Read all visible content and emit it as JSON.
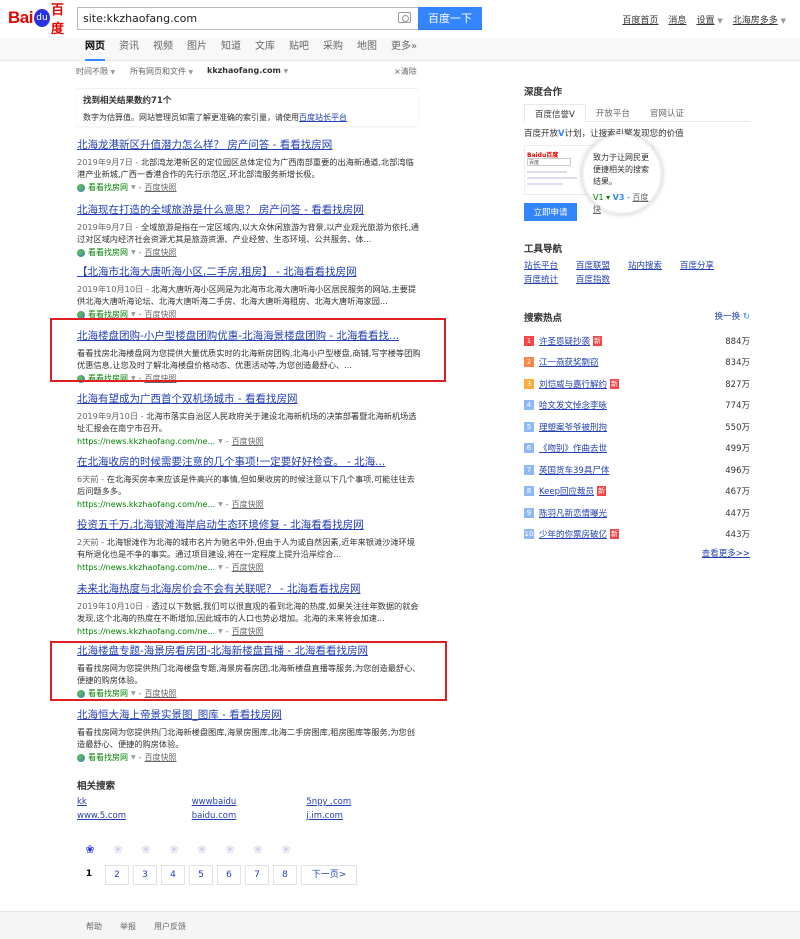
{
  "header": {
    "logo_bai": "Bai",
    "logo_du": "du",
    "logo_cn": "百度",
    "search_value": "site:kkzhaofang.com",
    "search_button": "百度一下",
    "links": [
      "百度首页",
      "消息",
      "设置",
      "北海房多多"
    ]
  },
  "tabs": [
    "网页",
    "资讯",
    "视频",
    "图片",
    "知道",
    "文库",
    "贴吧",
    "采购",
    "地图",
    "更多»"
  ],
  "filter": {
    "time": "时间不限",
    "type": "所有网页和文件",
    "site": "kkzhaofang.com",
    "clear": "清除"
  },
  "notice": {
    "title": "找到相关结果数约71个",
    "desc": "数字为估算值。网站管理员如需了解更准确的索引量，请使用",
    "link": "百度站长平台"
  },
  "results": [
    {
      "title": "北海龙港新区升值潜力怎么样？ 房产问答 - 看看找房网",
      "date": "2019年9月7日 - ",
      "abstract": "北部湾龙港新区的定位园区总体定位为广西南部重要的出海新通道,北部湾临港产业新城,广西一香港合作的先行示范区,环北部湾服务新增长极。",
      "src": "看看找房网",
      "cache": "百度快照"
    },
    {
      "title": "北海现在打造的全域旅游是什么意思？ 房产问答 - 看看找房网",
      "date": "2019年9月7日 - ",
      "abstract": "全域旅游是指在一定区域内,以大众休闲旅游为背景,以产业观光旅游为依托,通过对区域内经济社会资源尤其是旅游资源、产业经营、生态环境、公共服务、体...",
      "src": "看看找房网",
      "cache": "百度快照"
    },
    {
      "title": "【北海市北海大唐听海小区,二手房,租房】 - 北海看看找房网",
      "date": "2019年10月10日 - ",
      "abstract": "北海大唐听海小区网是为北海市北海大唐听海小区居民服务的网站,主要提供北海大唐听海论坛、北海大唐听海二手房、北海大唐听海租房、北海大唐听海家园...",
      "src": "看看找房网",
      "cache": "百度快照"
    },
    {
      "title": "北海楼盘团购-小户型楼盘团购优惠-北海海景楼盘团购 - 北海看看找...",
      "date": "",
      "abstract": "看看找房北海楼盘网为您提供大量优质实时的北海新房团购,北海小户型楼盘,商铺,写字楼等团购优惠信息,让您及时了解北海楼盘价格动态、优惠活动等,为您创造最舒心、...",
      "src": "看看找房网",
      "cache": "百度快照"
    },
    {
      "title": "北海有望成为广西首个双机场城市 - 看看找房网",
      "date": "2019年9月10日 - ",
      "abstract": "北海市落实自治区人民政府关于建设北海新机场的决策部署暨北海新机场选址汇报会在南宁市召开。",
      "src": "https://news.kkzhaofang.com/ne...",
      "cache": "百度快照"
    },
    {
      "title": "在北海收房的时候需要注意的几个事项!一定要好好检查。 - 北海...",
      "date": "6天前 - ",
      "abstract": "在北海买房本来应该是件高兴的事情,但如果收房的时候注意以下几个事项,可能往往去后问题多多。",
      "src": "https://news.kkzhaofang.com/ne...",
      "cache": "百度快照"
    },
    {
      "title": "投资五千万,北海银滩海岸启动生态环境修复 - 北海看看找房网",
      "date": "2天前 - ",
      "abstract": "北海银滩作为北海的城市名片为驰名中外,但由于人为或自然因素,近年来银滩沙滩环境有所退化也是不争的事实。通过项目建设,将在一定程度上提升沿岸综合...",
      "src": "https://news.kkzhaofang.com/ne...",
      "cache": "百度快照"
    },
    {
      "title": "未来北海热度与北海房价会不会有关联呢？ - 北海看看找房网",
      "date": "2019年10月10日 - ",
      "abstract": "透过以下数据,我们可以很直观的看到北海的热度,如果关注往年数据的就会发现,这个北海的热度在不断增加,因此城市的人口也势必增加。北海的未来将会加速...",
      "src": "https://news.kkzhaofang.com/ne...",
      "cache": "百度快照"
    },
    {
      "title": "北海楼盘专题-海景房看房团-北海新楼盘直播 - 北海看看找房网",
      "date": "",
      "abstract": "看看找房网为您提供热门北海楼盘专题,海景房看房团,北海新楼盘直播等服务,为您创造最舒心、便捷的购房体验。",
      "src": "看看找房网",
      "cache": "百度快照"
    },
    {
      "title": "北海恒大海上帝景实景图_图库 - 看看找房网",
      "date": "",
      "abstract": "看看找房网为您提供热门北海新楼盘图库,海景房图库,北海二手房图库,租房图库等服务,为您创造最舒心、便捷的购房体验。",
      "src": "看看找房网",
      "cache": "百度快照"
    }
  ],
  "related": {
    "title": "相关搜索",
    "items": [
      "kk",
      "wwwbaidu",
      "5npy .com",
      "www.5.com",
      "baidu.com",
      "j.im.com"
    ]
  },
  "pager": {
    "pages": [
      "1",
      "2",
      "3",
      "4",
      "5",
      "6",
      "7",
      "8"
    ],
    "current": "1",
    "next": "下一页>"
  },
  "footer": [
    "帮助",
    "举报",
    "用户反馈"
  ],
  "right": {
    "deep_title": "深度合作",
    "deep_tabs": [
      "百度信誉V",
      "开放平台",
      "官网认证"
    ],
    "deep_desc_pre": "百度开放",
    "deep_desc_v": "V",
    "deep_desc_post": "计划，让搜索引擎发现您的价值",
    "mini_logo": "Baidu百度",
    "mini_search": "百度",
    "magnifier_text": "致力于让网民更便捷相关的搜索结果。",
    "magnifier_v1": "V1",
    "magnifier_v3": "V3",
    "magnifier_cache": "百度快",
    "apply": "立即申请",
    "tools_title": "工具导航",
    "tools": [
      "站长平台",
      "百度联盟",
      "站内搜索",
      "百度分享",
      "百度统计",
      "百度指数"
    ],
    "hot_title": "搜索热点",
    "refresh": "换一换",
    "hot": [
      {
        "rank": "1",
        "title": "许圣恩疑抄袭",
        "new": "新",
        "count": "884万",
        "color": "#f54545"
      },
      {
        "rank": "2",
        "title": "江一燕获奖剽窃",
        "new": "",
        "count": "834万",
        "color": "#ff8547"
      },
      {
        "rank": "3",
        "title": "刘恺威与嘉行解约",
        "new": "新",
        "count": "827万",
        "color": "#ffac38"
      },
      {
        "rank": "4",
        "title": "哈文发文悼念李咏",
        "new": "",
        "count": "774万",
        "color": "#8eb9f5"
      },
      {
        "rank": "5",
        "title": "理塑案爷爷被刑拘",
        "new": "",
        "count": "550万",
        "color": "#8eb9f5"
      },
      {
        "rank": "6",
        "title": "《吻别》作曲去世",
        "new": "",
        "count": "499万",
        "color": "#8eb9f5"
      },
      {
        "rank": "7",
        "title": "英国货车39具尸体",
        "new": "",
        "count": "496万",
        "color": "#8eb9f5"
      },
      {
        "rank": "8",
        "title": "Keep回应裁员",
        "new": "新",
        "count": "467万",
        "color": "#8eb9f5"
      },
      {
        "rank": "9",
        "title": "陈羽凡新恋情曝光",
        "new": "",
        "count": "447万",
        "color": "#8eb9f5"
      },
      {
        "rank": "10",
        "title": "少年的你票房破亿",
        "new": "新",
        "count": "443万",
        "color": "#8eb9f5"
      }
    ],
    "more": "查看更多>>"
  }
}
